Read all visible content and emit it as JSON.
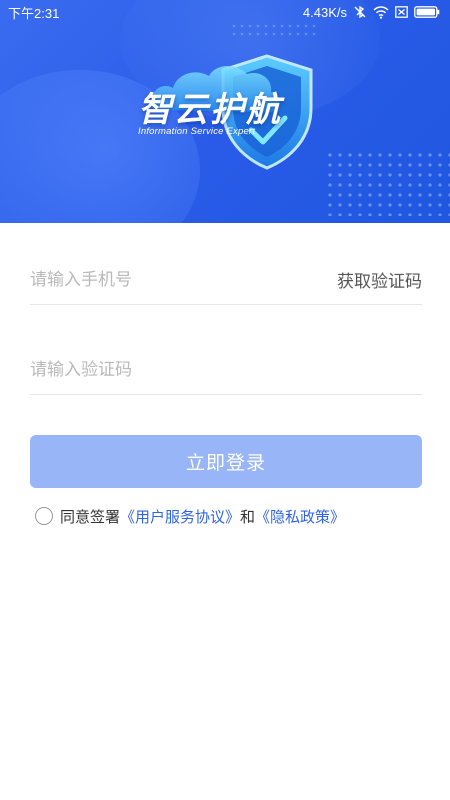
{
  "status_bar": {
    "time": "下午2:31",
    "speed": "4.43K/s",
    "icons": [
      "bluetooth-off-icon",
      "wifi-icon",
      "no-sim-icon",
      "battery-icon"
    ]
  },
  "banner": {
    "logo_title": "智云护航",
    "logo_subtitle": "Information Service Expert",
    "colors": {
      "primary": "#2b5ce9",
      "accent_light": "#4cc6ff"
    }
  },
  "form": {
    "phone_placeholder": "请输入手机号",
    "get_code_label": "获取验证码",
    "code_placeholder": "请输入验证码",
    "login_label": "立即登录"
  },
  "agreement": {
    "prefix": "同意签署",
    "user_agreement": "《用户服务协议》",
    "conjunction": "和",
    "privacy_policy": "《隐私政策》"
  },
  "colors": {
    "button_disabled": "#97b5f7",
    "link": "#2f64e3"
  }
}
